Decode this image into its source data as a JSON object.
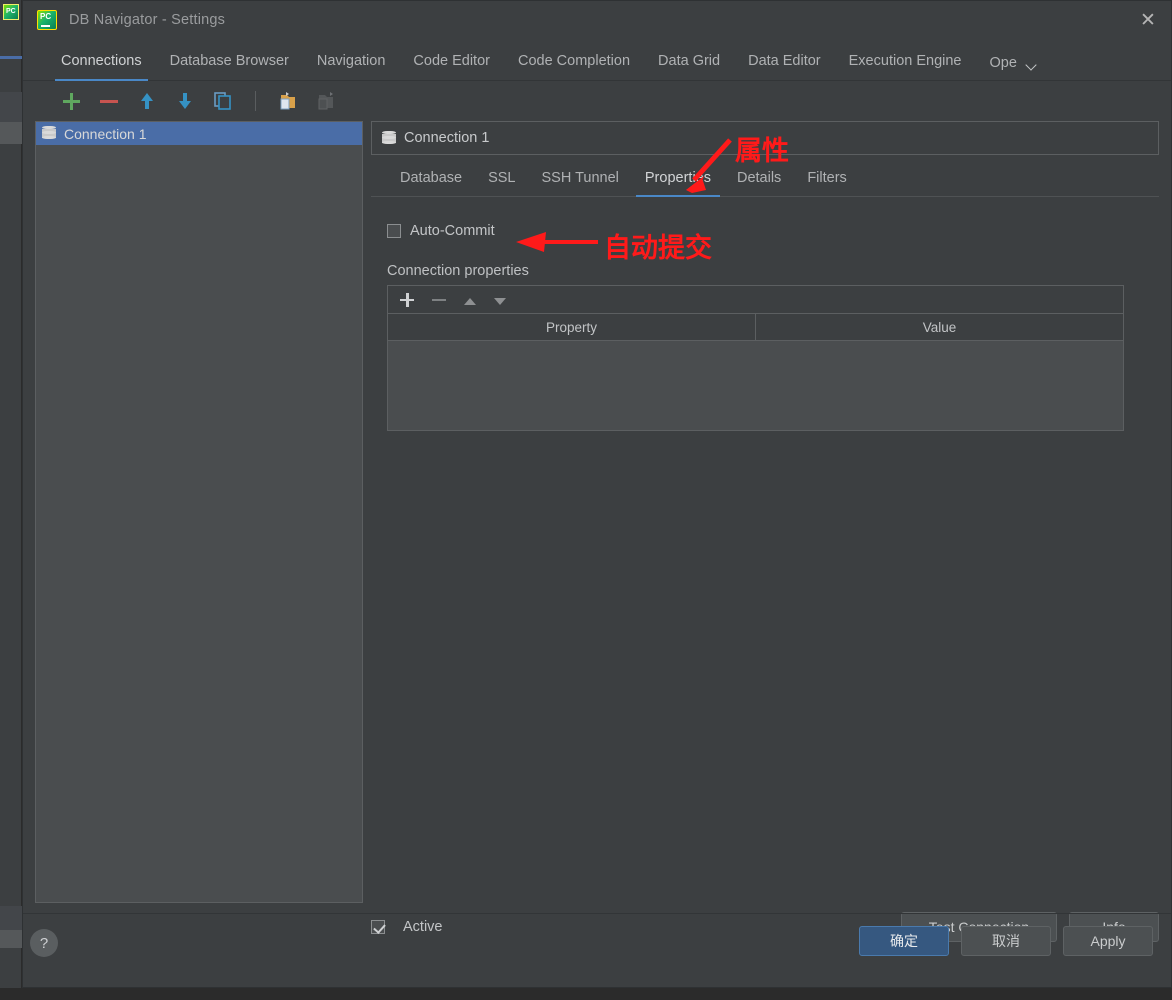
{
  "window": {
    "title": "DB Navigator - Settings",
    "app_icon": "pycharm-logo-icon",
    "close_label": "✕"
  },
  "top_tabs": {
    "items": [
      {
        "label": "Connections",
        "active": true
      },
      {
        "label": "Database Browser",
        "active": false
      },
      {
        "label": "Navigation",
        "active": false
      },
      {
        "label": "Code Editor",
        "active": false
      },
      {
        "label": "Code Completion",
        "active": false
      },
      {
        "label": "Data Grid",
        "active": false
      },
      {
        "label": "Data Editor",
        "active": false
      },
      {
        "label": "Execution Engine",
        "active": false
      },
      {
        "label": "Ope",
        "active": false
      }
    ],
    "overflow_icon": "chevron-down-icon"
  },
  "toolbar": {
    "items": [
      {
        "name": "add-connection-button",
        "icon": "plus-icon"
      },
      {
        "name": "remove-connection-button",
        "icon": "minus-icon"
      },
      {
        "name": "move-up-button",
        "icon": "arrow-up-icon"
      },
      {
        "name": "move-down-button",
        "icon": "arrow-down-icon"
      },
      {
        "name": "copy-button",
        "icon": "copy-icon"
      },
      {
        "name": "paste-button",
        "icon": "paste-icon"
      },
      {
        "name": "paste-disabled-button",
        "icon": "paste-disabled-icon"
      }
    ]
  },
  "connection_list": {
    "items": [
      {
        "label": "Connection 1",
        "icon": "database-icon",
        "selected": true
      }
    ]
  },
  "detail": {
    "header": {
      "label": "Connection 1",
      "icon": "database-icon"
    },
    "tabs": [
      {
        "label": "Database",
        "active": false
      },
      {
        "label": "SSL",
        "active": false
      },
      {
        "label": "SSH Tunnel",
        "active": false
      },
      {
        "label": "Properties",
        "active": true
      },
      {
        "label": "Details",
        "active": false
      },
      {
        "label": "Filters",
        "active": false
      }
    ],
    "auto_commit": {
      "label": "Auto-Commit",
      "checked": false
    },
    "section_label": "Connection properties",
    "properties_table": {
      "toolbar": [
        {
          "name": "add-property-button",
          "icon": "plus-icon"
        },
        {
          "name": "remove-property-button",
          "icon": "minus-icon"
        },
        {
          "name": "move-property-up-button",
          "icon": "triangle-up-icon"
        },
        {
          "name": "move-property-down-button",
          "icon": "triangle-down-icon"
        }
      ],
      "columns": [
        "Property",
        "Value"
      ],
      "rows": []
    },
    "active_checkbox": {
      "label": "Active",
      "checked": true
    },
    "test_connection_label": "Test Connection",
    "info_label": "Info"
  },
  "footer": {
    "help_label": "?",
    "ok_label": "确定",
    "cancel_label": "取消",
    "apply_label": "Apply"
  },
  "annotations": [
    {
      "text": "属性",
      "target": "properties-tab",
      "arrow": "diagonal-down-left"
    },
    {
      "text": "自动提交",
      "target": "auto-commit-checkbox",
      "arrow": "horizontal-left"
    }
  ],
  "colors": {
    "accent": "#4a88c7",
    "selection": "#4a6da7",
    "primary_button": "#365880",
    "annotation": "#ff1a1a",
    "window_bg": "#3c3f41",
    "panel_bg": "#4a4d4f"
  }
}
